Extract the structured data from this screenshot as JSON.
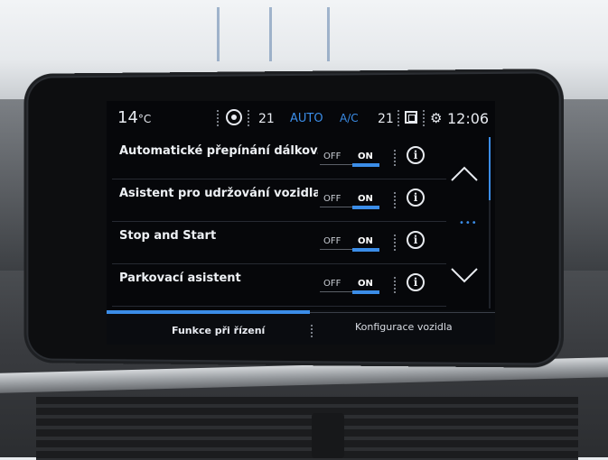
{
  "statusbar": {
    "outside_temp": "14",
    "outside_temp_unit": "°C",
    "left_temp": "21",
    "auto_label": "AUTO",
    "ac_label": "A/C",
    "right_temp": "21",
    "clock": "12:06"
  },
  "settings": {
    "items": [
      {
        "label": "Automatické přepínání dálkov...",
        "off": "OFF",
        "on": "ON",
        "state": "ON"
      },
      {
        "label": "Asistent pro udržování vozidla...",
        "off": "OFF",
        "on": "ON",
        "state": "ON"
      },
      {
        "label": "Stop and Start",
        "off": "OFF",
        "on": "ON",
        "state": "ON"
      },
      {
        "label": "Parkovací asistent",
        "off": "OFF",
        "on": "ON",
        "state": "ON"
      }
    ],
    "info_glyph": "i"
  },
  "tabs": [
    {
      "label": "Funkce při řízení",
      "active": true
    },
    {
      "label": "Konfigurace vozidla",
      "active": false
    }
  ],
  "colors": {
    "accent": "#3b8de8",
    "background": "#06070a"
  },
  "icons": [
    "fan-icon",
    "recirculation-icon",
    "screens-icon",
    "gear-icon",
    "info-icon",
    "chevron-up-icon",
    "chevron-down-icon"
  ]
}
